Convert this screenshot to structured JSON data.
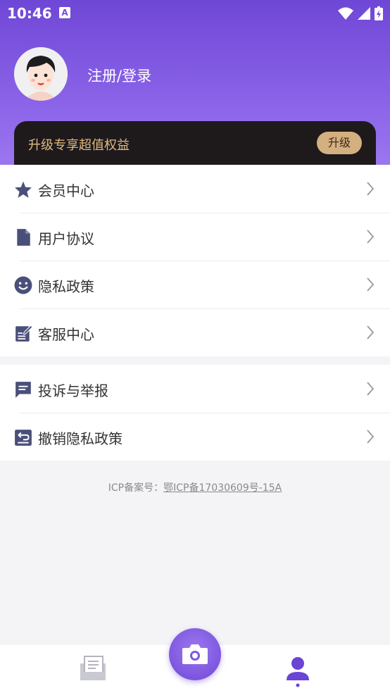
{
  "status": {
    "time": "10:46",
    "notification": "A"
  },
  "header": {
    "login_label": "注册/登录"
  },
  "vip": {
    "text": "升级专享超值权益",
    "button": "升级"
  },
  "menu_group_1": [
    {
      "label": "会员中心",
      "icon": "star-icon"
    },
    {
      "label": "用户协议",
      "icon": "document-icon"
    },
    {
      "label": "隐私政策",
      "icon": "smile-icon"
    },
    {
      "label": "客服中心",
      "icon": "edit-note-icon"
    }
  ],
  "menu_group_2": [
    {
      "label": "投诉与举报",
      "icon": "chat-icon"
    },
    {
      "label": "撤销隐私政策",
      "icon": "revoke-icon"
    }
  ],
  "footer": {
    "icp_prefix": "ICP备案号：",
    "icp_number": "鄂ICP备17030609号-15A"
  },
  "colors": {
    "accent": "#7048d8",
    "vip_gold": "#d4af80",
    "icon": "#4a4f7a"
  }
}
